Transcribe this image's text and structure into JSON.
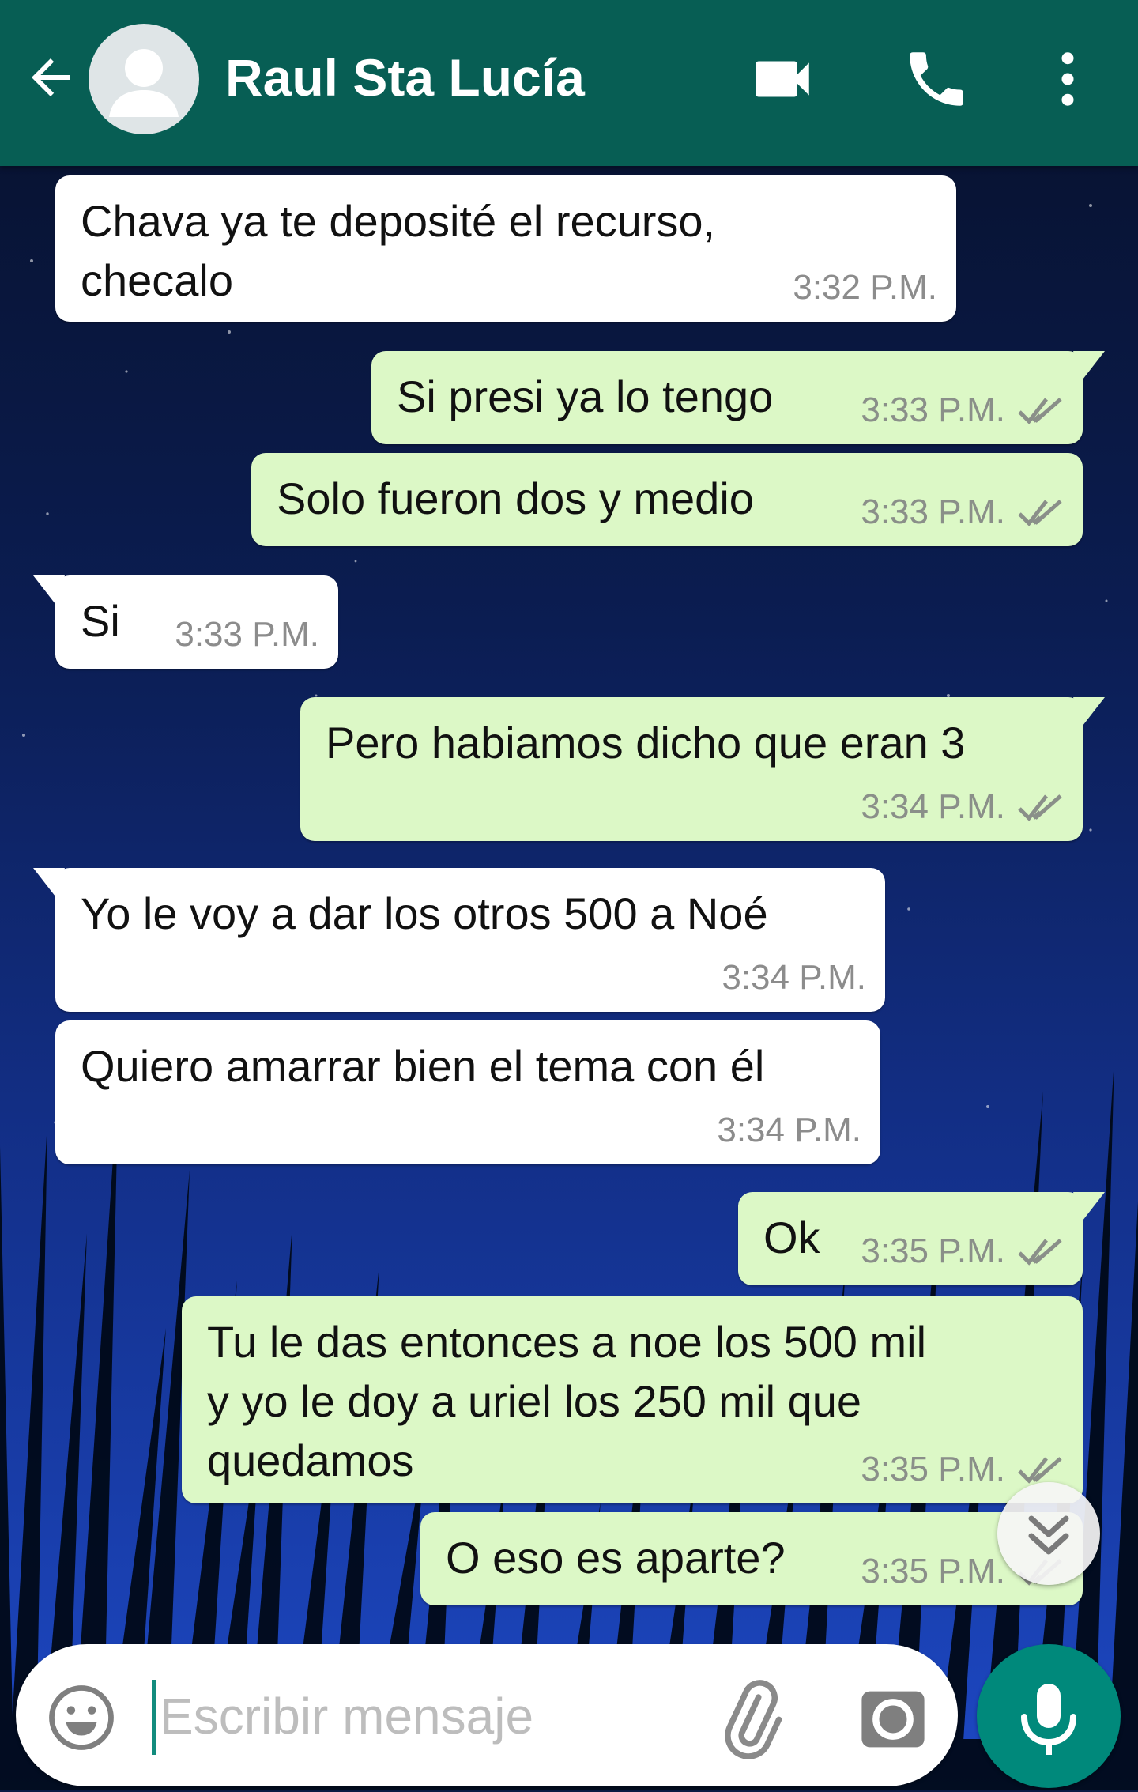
{
  "header": {
    "contact_name": "Raul Sta Lucía",
    "icons": [
      "back-arrow-icon",
      "avatar-placeholder",
      "video-call-icon",
      "phone-icon",
      "more-vert-icon"
    ]
  },
  "messages": [
    {
      "direction": "in",
      "text": "Chava ya te deposité el recurso,\nchecalo",
      "time": "3:32 P.M."
    },
    {
      "direction": "out",
      "text": "Si presi ya lo tengo",
      "time": "3:33 P.M.",
      "status": "read"
    },
    {
      "direction": "out",
      "text": "Solo fueron dos y medio",
      "time": "3:33 P.M.",
      "status": "read"
    },
    {
      "direction": "in",
      "text": "Si",
      "time": "3:33 P.M."
    },
    {
      "direction": "out",
      "text": "Pero habiamos dicho que eran 3",
      "time": "3:34 P.M.",
      "status": "read"
    },
    {
      "direction": "in",
      "text": "Yo le voy a dar los otros 500 a Noé",
      "time": "3:34 P.M."
    },
    {
      "direction": "in",
      "text": "Quiero amarrar bien el tema con él",
      "time": "3:34 P.M."
    },
    {
      "direction": "out",
      "text": "Ok",
      "time": "3:35 P.M.",
      "status": "read"
    },
    {
      "direction": "out",
      "text": "Tu le das entonces a noe los 500 mil\ny yo le doy a uriel los 250 mil que\nquedamos",
      "time": "3:35 P.M.",
      "status": "read"
    },
    {
      "direction": "out",
      "text": "O eso es aparte?",
      "time": "3:35 P.M.",
      "status": "read"
    }
  ],
  "composer": {
    "placeholder": "Escribir mensaje",
    "value": ""
  },
  "colors": {
    "header": "#075e54",
    "outgoing_bubble": "#dcf8c6",
    "incoming_bubble": "#ffffff",
    "mic_button": "#00897b",
    "read_ticks": "#8a8f89"
  }
}
